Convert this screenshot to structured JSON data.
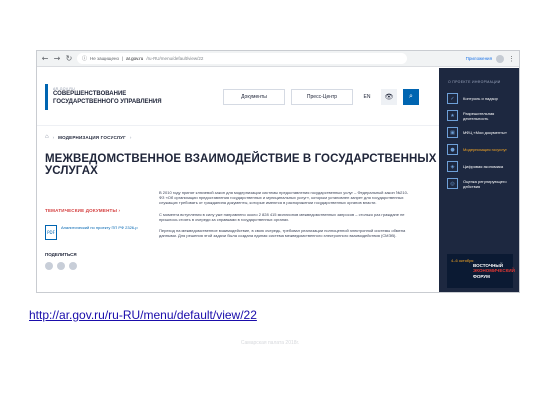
{
  "browser": {
    "security_label": "Не защищено",
    "url_host": "ar.gov.ru",
    "url_path": "/ru-RU/menu/default/view/22",
    "apps_label": "Приложения"
  },
  "site": {
    "logo_small": "AR.GOV.RU",
    "logo_line1": "СОВЕРШЕНСТВОВАНИЕ",
    "logo_line2": "ГОСУДАРСТВЕННОГО УПРАВЛЕНИЯ",
    "nav_docs": "Документы",
    "nav_press": "Пресс-Центр",
    "lang": "EN",
    "vision_glyph": "👁",
    "search_glyph": "⌕"
  },
  "breadcrumb": {
    "home_glyph": "⌂",
    "sep": "›",
    "current": "МОДЕРНИЗАЦИЯ ГОСУСЛУГ",
    "after": "›"
  },
  "page": {
    "title": "МЕЖВЕДОМСТВЕННОЕ ВЗАИМОДЕЙСТВИЕ В ГОСУДАРСТВЕННЫХ УСЛУГАХ"
  },
  "left_col": {
    "topic_link": "ТЕМАТИЧЕСКИЕ ДОКУМЕНТЫ  ›",
    "doc_ext": "PDF",
    "doc_text": "Аналитический по проекту ПП РФ 2326-р",
    "share_label": "ПОДЕЛИТЬСЯ"
  },
  "paragraphs": [
    "В 2010 году принят ключевой закон для модернизации системы предоставления государственных услуг – Федеральный закон №210-ФЗ «Об организации предоставления государственных и муниципальных услуг», которым установлен запрет для государственных служащих требовать от гражданина документы, которые имеются в распоряжении государственных органов власти.",
    "С момента вступления в силу уже направлено около 2 828 415 миллионов межведомственных запросов – столько раз граждане не пришлось стоять в очереди за справками в государственных органах.",
    "Переход на межведомственное взаимодействие, в свою очередь, требовал реализации полноценной электронной системы обмена данными. Для решения этой задачи была создана единая система межведомственного электронного взаимодействия (СМЭВ)."
  ],
  "sidebar": {
    "title": "О ПРОЕКТЕ ИНФОРМАЦИИ",
    "items": [
      {
        "icon": "✓",
        "label": "Контроль и надзор",
        "highlight": false
      },
      {
        "icon": "★",
        "label": "Разрешительная деятельность",
        "highlight": false
      },
      {
        "icon": "▣",
        "label": "МФЦ «Мои документы»",
        "highlight": false
      },
      {
        "icon": "●",
        "label": "Модернизация госуслуг",
        "highlight": true
      },
      {
        "icon": "◈",
        "label": "Цифровая экономика",
        "highlight": false
      },
      {
        "icon": "◎",
        "label": "Оценка регулирующего действия",
        "highlight": false
      }
    ],
    "forum_date": "4–6 октября",
    "forum_line1": "ВОСТОЧНЫЙ",
    "forum_line2": "ЭКОНОМИЧЕСКИЙ",
    "forum_line3": "ФОРУМ"
  },
  "caption": {
    "url": "http://ar.gov.ru/ru-RU/menu/default/view/22"
  },
  "footer": {
    "watermark": "Самарская палата 2018г."
  }
}
